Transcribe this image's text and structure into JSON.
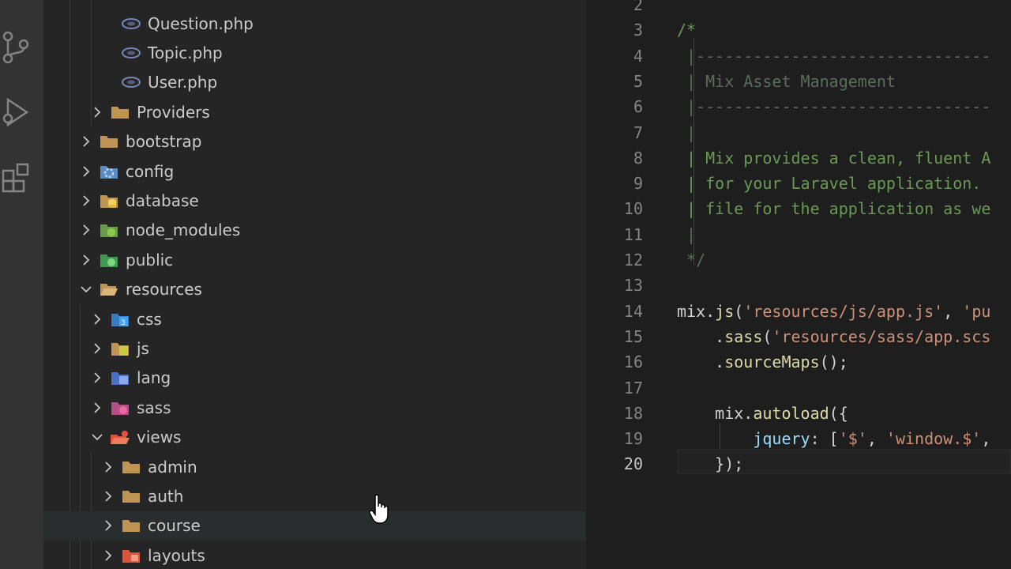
{
  "explorer": {
    "items": [
      {
        "label": "Question.php",
        "type": "php",
        "depth": 3,
        "chevron": "none"
      },
      {
        "label": "Topic.php",
        "type": "php",
        "depth": 3,
        "chevron": "none"
      },
      {
        "label": "User.php",
        "type": "php",
        "depth": 3,
        "chevron": "none"
      },
      {
        "label": "Providers",
        "type": "folder",
        "depth": 2,
        "chevron": "right"
      },
      {
        "label": "bootstrap",
        "type": "folder",
        "depth": 1,
        "chevron": "right"
      },
      {
        "label": "config",
        "type": "config",
        "depth": 1,
        "chevron": "right"
      },
      {
        "label": "database",
        "type": "database",
        "depth": 1,
        "chevron": "right"
      },
      {
        "label": "node_modules",
        "type": "node",
        "depth": 1,
        "chevron": "right"
      },
      {
        "label": "public",
        "type": "public",
        "depth": 1,
        "chevron": "right"
      },
      {
        "label": "resources",
        "type": "folder-open",
        "depth": 1,
        "chevron": "down"
      },
      {
        "label": "css",
        "type": "css",
        "depth": 2,
        "chevron": "right"
      },
      {
        "label": "js",
        "type": "js",
        "depth": 2,
        "chevron": "right"
      },
      {
        "label": "lang",
        "type": "lang",
        "depth": 2,
        "chevron": "right"
      },
      {
        "label": "sass",
        "type": "sass",
        "depth": 2,
        "chevron": "right"
      },
      {
        "label": "views",
        "type": "views",
        "depth": 2,
        "chevron": "down"
      },
      {
        "label": "admin",
        "type": "folder",
        "depth": 3,
        "chevron": "right"
      },
      {
        "label": "auth",
        "type": "folder",
        "depth": 3,
        "chevron": "right"
      },
      {
        "label": "course",
        "type": "folder",
        "depth": 3,
        "chevron": "right",
        "hovered": true
      },
      {
        "label": "layouts",
        "type": "layouts",
        "depth": 3,
        "chevron": "right"
      }
    ]
  },
  "editor": {
    "active_line": "20",
    "lines": [
      {
        "n": "2",
        "segments": []
      },
      {
        "n": "3",
        "segments": [
          {
            "t": "/*",
            "c": "c-comment"
          }
        ]
      },
      {
        "n": "4",
        "segments": [
          {
            "t": " |-------------------------------",
            "c": "c-dim"
          }
        ]
      },
      {
        "n": "5",
        "segments": [
          {
            "t": " | Mix Asset Management",
            "c": "c-dim"
          }
        ]
      },
      {
        "n": "6",
        "segments": [
          {
            "t": " |-------------------------------",
            "c": "c-dim"
          }
        ]
      },
      {
        "n": "7",
        "segments": [
          {
            "t": " |",
            "c": "c-dim"
          }
        ]
      },
      {
        "n": "8",
        "segments": [
          {
            "t": " | Mix provides a clean, fluent A",
            "c": "c-comment"
          }
        ]
      },
      {
        "n": "9",
        "segments": [
          {
            "t": " | for your Laravel application.",
            "c": "c-comment"
          }
        ]
      },
      {
        "n": "10",
        "segments": [
          {
            "t": " | file for the application as we",
            "c": "c-comment"
          }
        ]
      },
      {
        "n": "11",
        "segments": [
          {
            "t": " |",
            "c": "c-dim"
          }
        ]
      },
      {
        "n": "12",
        "segments": [
          {
            "t": " */",
            "c": "c-dim"
          }
        ]
      },
      {
        "n": "13",
        "segments": []
      },
      {
        "n": "14",
        "segments": [
          {
            "t": "mix",
            "c": "c-plain"
          },
          {
            "t": ".",
            "c": "c-punc"
          },
          {
            "t": "js",
            "c": "c-fn"
          },
          {
            "t": "(",
            "c": "c-punc"
          },
          {
            "t": "'resources/js/app.js'",
            "c": "c-str"
          },
          {
            "t": ", ",
            "c": "c-punc"
          },
          {
            "t": "'pu",
            "c": "c-str"
          }
        ]
      },
      {
        "n": "15",
        "segments": [
          {
            "t": "    .",
            "c": "c-punc"
          },
          {
            "t": "sass",
            "c": "c-fn"
          },
          {
            "t": "(",
            "c": "c-punc"
          },
          {
            "t": "'resources/sass/app.scs",
            "c": "c-str"
          }
        ]
      },
      {
        "n": "16",
        "segments": [
          {
            "t": "    .",
            "c": "c-punc"
          },
          {
            "t": "sourceMaps",
            "c": "c-fn"
          },
          {
            "t": "();",
            "c": "c-punc"
          }
        ]
      },
      {
        "n": "17",
        "segments": []
      },
      {
        "n": "18",
        "segments": [
          {
            "t": "    mix",
            "c": "c-plain"
          },
          {
            "t": ".",
            "c": "c-punc"
          },
          {
            "t": "autoload",
            "c": "c-fn"
          },
          {
            "t": "({",
            "c": "c-punc"
          }
        ]
      },
      {
        "n": "19",
        "segments": [
          {
            "t": "        ",
            "c": "c-plain"
          },
          {
            "t": "jquery",
            "c": "c-id"
          },
          {
            "t": ": [",
            "c": "c-punc"
          },
          {
            "t": "'$'",
            "c": "c-str"
          },
          {
            "t": ", ",
            "c": "c-punc"
          },
          {
            "t": "'window.$'",
            "c": "c-str"
          },
          {
            "t": ",",
            "c": "c-punc"
          }
        ]
      },
      {
        "n": "20",
        "segments": [
          {
            "t": "    });",
            "c": "c-punc"
          }
        ]
      }
    ]
  },
  "colors": {
    "folder": "#c09553",
    "php": "#7a86b8",
    "css": "#42a5f5",
    "js": "#cbcb41",
    "sass": "#e76aa0",
    "views": "#e0533a"
  }
}
